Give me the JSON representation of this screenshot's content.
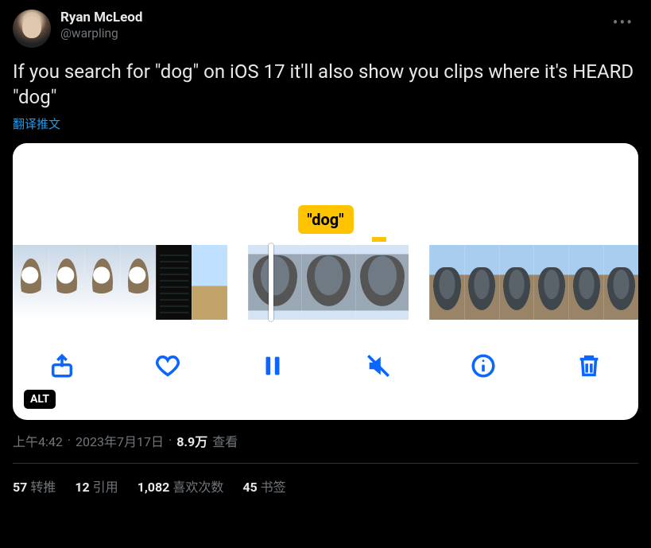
{
  "author": {
    "display_name": "Ryan McLeod",
    "handle": "@warpling"
  },
  "tweet_text": "If you search for \"dog\" on iOS 17 it'll also show you clips where it's HEARD \"dog\"",
  "translate_label": "翻译推文",
  "media": {
    "badge_text": "\"dog\"",
    "alt_label": "ALT"
  },
  "meta": {
    "time": "上午4:42",
    "sep1": " · ",
    "date": "2023年7月17日",
    "sep2": " · ",
    "views_count": "8.9万",
    "views_label": " 查看"
  },
  "stats": {
    "retweets_count": "57",
    "retweets_label": " 转推",
    "quotes_count": "12",
    "quotes_label": " 引用",
    "likes_count": "1,082",
    "likes_label": " 喜欢次数",
    "bookmarks_count": "45",
    "bookmarks_label": " 书签"
  }
}
